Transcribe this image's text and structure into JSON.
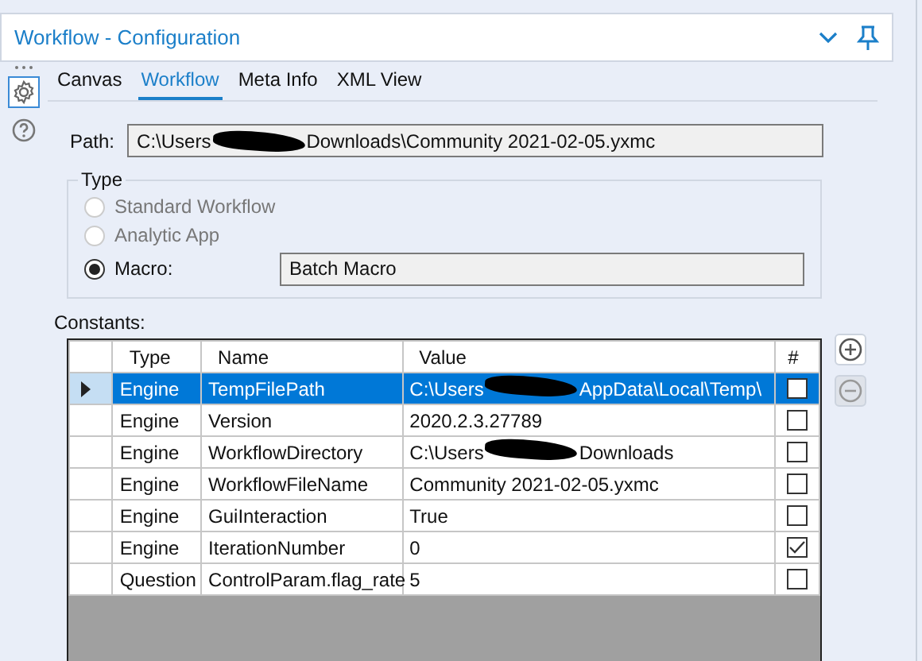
{
  "window": {
    "title": "Workflow - Configuration"
  },
  "tabs": [
    {
      "label": "Canvas",
      "selected": false
    },
    {
      "label": "Workflow",
      "selected": true
    },
    {
      "label": "Meta Info",
      "selected": false
    },
    {
      "label": "XML View",
      "selected": false
    }
  ],
  "sidebar": {
    "items": [
      {
        "kind": "settings",
        "selected": true
      },
      {
        "kind": "help",
        "selected": false
      }
    ]
  },
  "path": {
    "label": "Path:",
    "value_parts": [
      "C:\\Users",
      "Downloads\\Community 2021-02-05.yxmc"
    ]
  },
  "type_group": {
    "legend": "Type",
    "options": [
      {
        "label": "Standard Workflow",
        "selected": false,
        "disabled": true
      },
      {
        "label": "Analytic App",
        "selected": false,
        "disabled": true
      },
      {
        "label": "Macro:",
        "selected": true,
        "disabled": false,
        "field_value": "Batch Macro"
      }
    ]
  },
  "constants": {
    "label": "Constants:",
    "columns": [
      "Type",
      "Name",
      "Value",
      "#"
    ],
    "rows": [
      {
        "type": "Engine",
        "name": "TempFilePath",
        "value_parts": [
          "C:\\Users",
          "AppData\\Local\\Temp\\"
        ],
        "checked": false,
        "selected": true
      },
      {
        "type": "Engine",
        "name": "Version",
        "value_parts": [
          "2020.2.3.27789"
        ],
        "checked": false,
        "selected": false
      },
      {
        "type": "Engine",
        "name": "WorkflowDirectory",
        "value_parts": [
          "C:\\Users",
          "Downloads"
        ],
        "checked": false,
        "selected": false
      },
      {
        "type": "Engine",
        "name": "WorkflowFileName",
        "value_parts": [
          "Community 2021-02-05.yxmc"
        ],
        "checked": false,
        "selected": false
      },
      {
        "type": "Engine",
        "name": "GuiInteraction",
        "value_parts": [
          "True"
        ],
        "checked": false,
        "selected": false
      },
      {
        "type": "Engine",
        "name": "IterationNumber",
        "value_parts": [
          "0"
        ],
        "checked": true,
        "selected": false
      },
      {
        "type": "Question",
        "name": "ControlParam.flag_rate",
        "value_parts": [
          "5"
        ],
        "checked": false,
        "selected": false
      }
    ],
    "buttons": [
      {
        "kind": "add",
        "disabled": false
      },
      {
        "kind": "remove",
        "disabled": true
      }
    ]
  }
}
